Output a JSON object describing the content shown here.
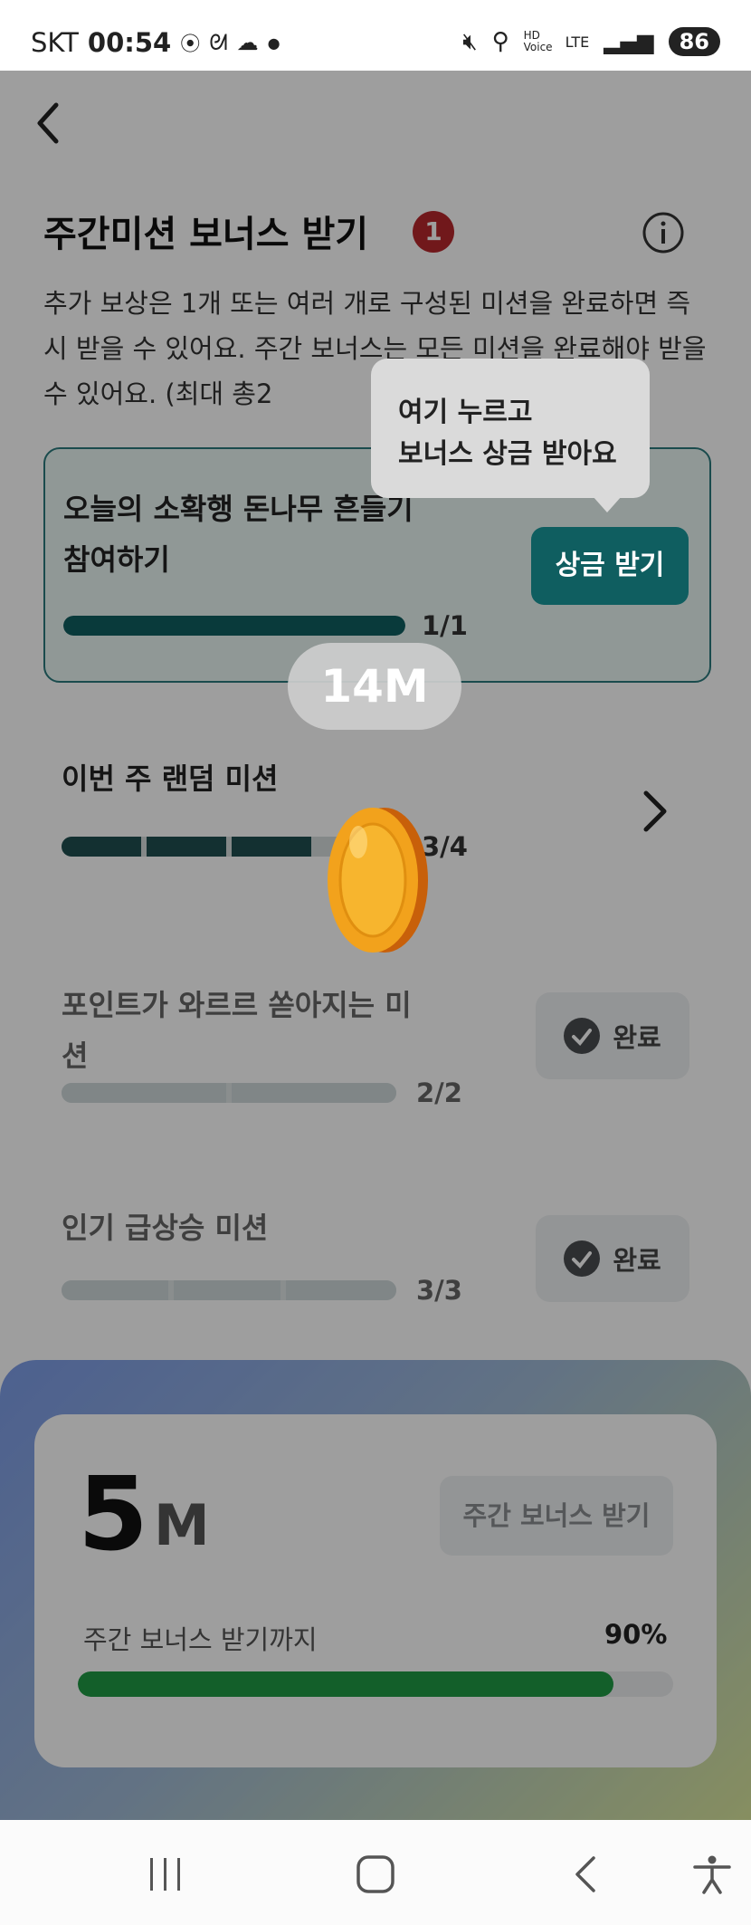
{
  "status_bar": {
    "carrier": "SKT",
    "time": "00:54",
    "battery": "86",
    "network": "LTE",
    "hd_voice": "HD Voice"
  },
  "header": {
    "title": "주간미션 보너스 받기",
    "badge_count": "1"
  },
  "description": "추가 보상은 1개 또는 여러 개로 구성된 미션을 완료하면 즉시 받을 수 있어요. 주간 보너스는 모든 미션을 완료해야 받을 수 있어요. (최대 총2",
  "tooltip": {
    "line1": "여기 누르고",
    "line2": "보너스 상금 받아요"
  },
  "missions": [
    {
      "title_line1": "오늘의 소확행 돈나무 흔들기",
      "title_line2": "참여하기",
      "progress": "1/1",
      "progress_fraction": 1.0,
      "button_label": "상금 받기"
    },
    {
      "title_line1": "이번 주 랜덤 미션",
      "progress": "3/4",
      "progress_fraction": 0.75
    },
    {
      "title_line1": "포인트가 와르르 쏟아지는 미",
      "title_line2": "션",
      "progress": "2/2",
      "progress_fraction": 1.0,
      "button_label": "완료"
    },
    {
      "title_line1": "인기 급상승 미션",
      "progress": "3/3",
      "progress_fraction": 1.0,
      "button_label": "완료"
    }
  ],
  "toast": "14M",
  "bonus": {
    "amount": "5",
    "unit": "M",
    "button_label": "주간 보너스 받기",
    "progress_label": "주간 보너스 받기까지",
    "progress_percent": "90%",
    "progress_value": 0.9
  },
  "colors": {
    "accent": "#0f5e60",
    "badge": "#b7282c",
    "progress_green": "#1f9a45"
  },
  "nav": {
    "recent": "recent-apps-icon",
    "home": "home-icon",
    "back": "back-icon",
    "accessibility": "accessibility-icon"
  }
}
